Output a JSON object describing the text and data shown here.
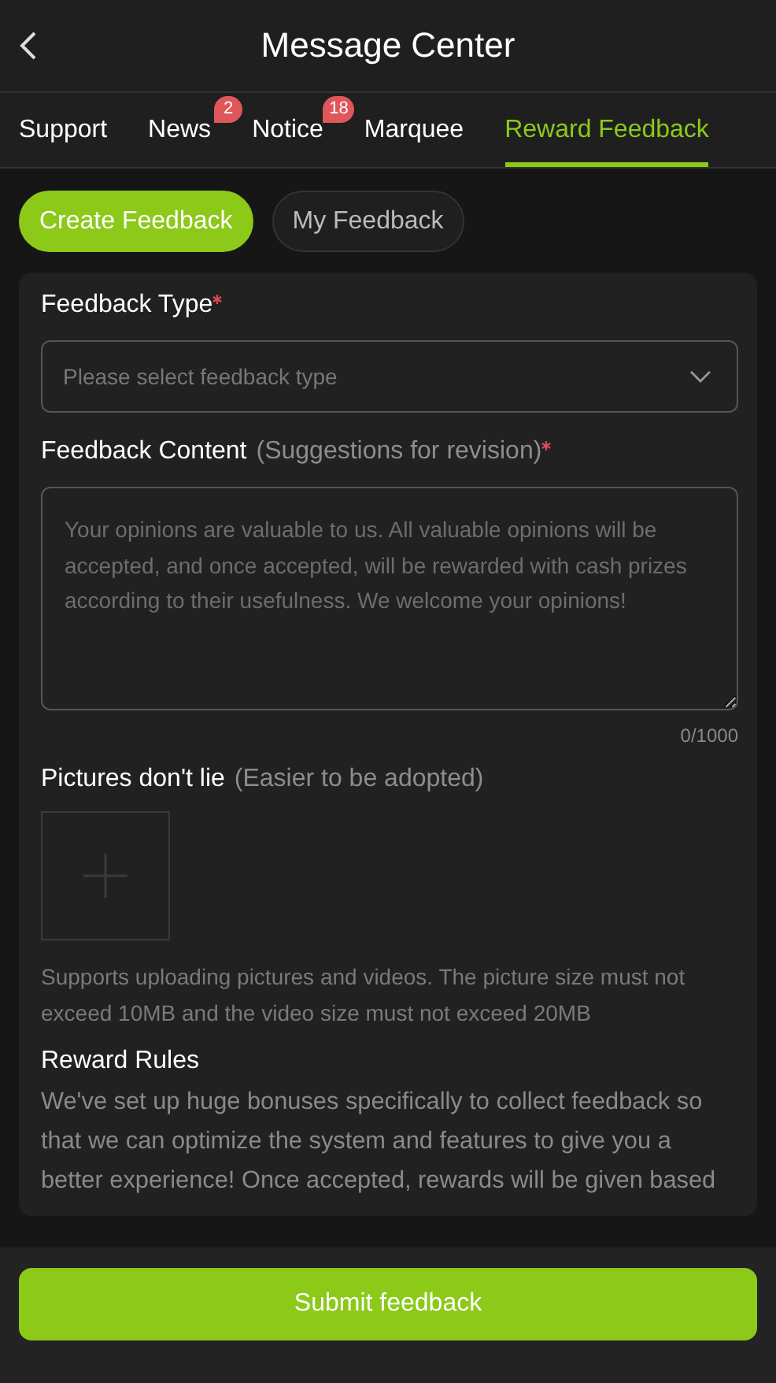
{
  "header": {
    "title": "Message Center"
  },
  "tabs": [
    {
      "label": "Support",
      "selected": false
    },
    {
      "label": "News",
      "selected": false,
      "badge": "2"
    },
    {
      "label": "Notice",
      "selected": false,
      "badge": "18"
    },
    {
      "label": "Marquee",
      "selected": false
    },
    {
      "label": "Reward Feedback",
      "selected": true
    }
  ],
  "subtabs": [
    {
      "label": "Create Feedback",
      "selected": true
    },
    {
      "label": "My Feedback",
      "selected": false
    }
  ],
  "form": {
    "type_label": "Feedback Type",
    "type_required": true,
    "type_placeholder": "Please select feedback type",
    "content_label": "Feedback Content",
    "content_hint": "(Suggestions for revision)",
    "content_required": true,
    "content_placeholder": "Your opinions are valuable to us. All valuable opinions will be accepted, and once accepted, will be rewarded with cash prizes according to their usefulness. We welcome your opinions!",
    "counter": "0/1000",
    "pictures_label": "Pictures don't lie",
    "pictures_hint": "(Easier to be adopted)",
    "upload_note": "Supports uploading pictures and videos. The picture size must not exceed 10MB and the video size must not exceed 20MB",
    "rules_title": "Reward Rules",
    "rules_text": "We've set up huge bonuses specifically to collect feedback so that we can optimize the system and features to give you a better experience! Once accepted, rewards will be given based"
  },
  "submit": "Submit feedback"
}
